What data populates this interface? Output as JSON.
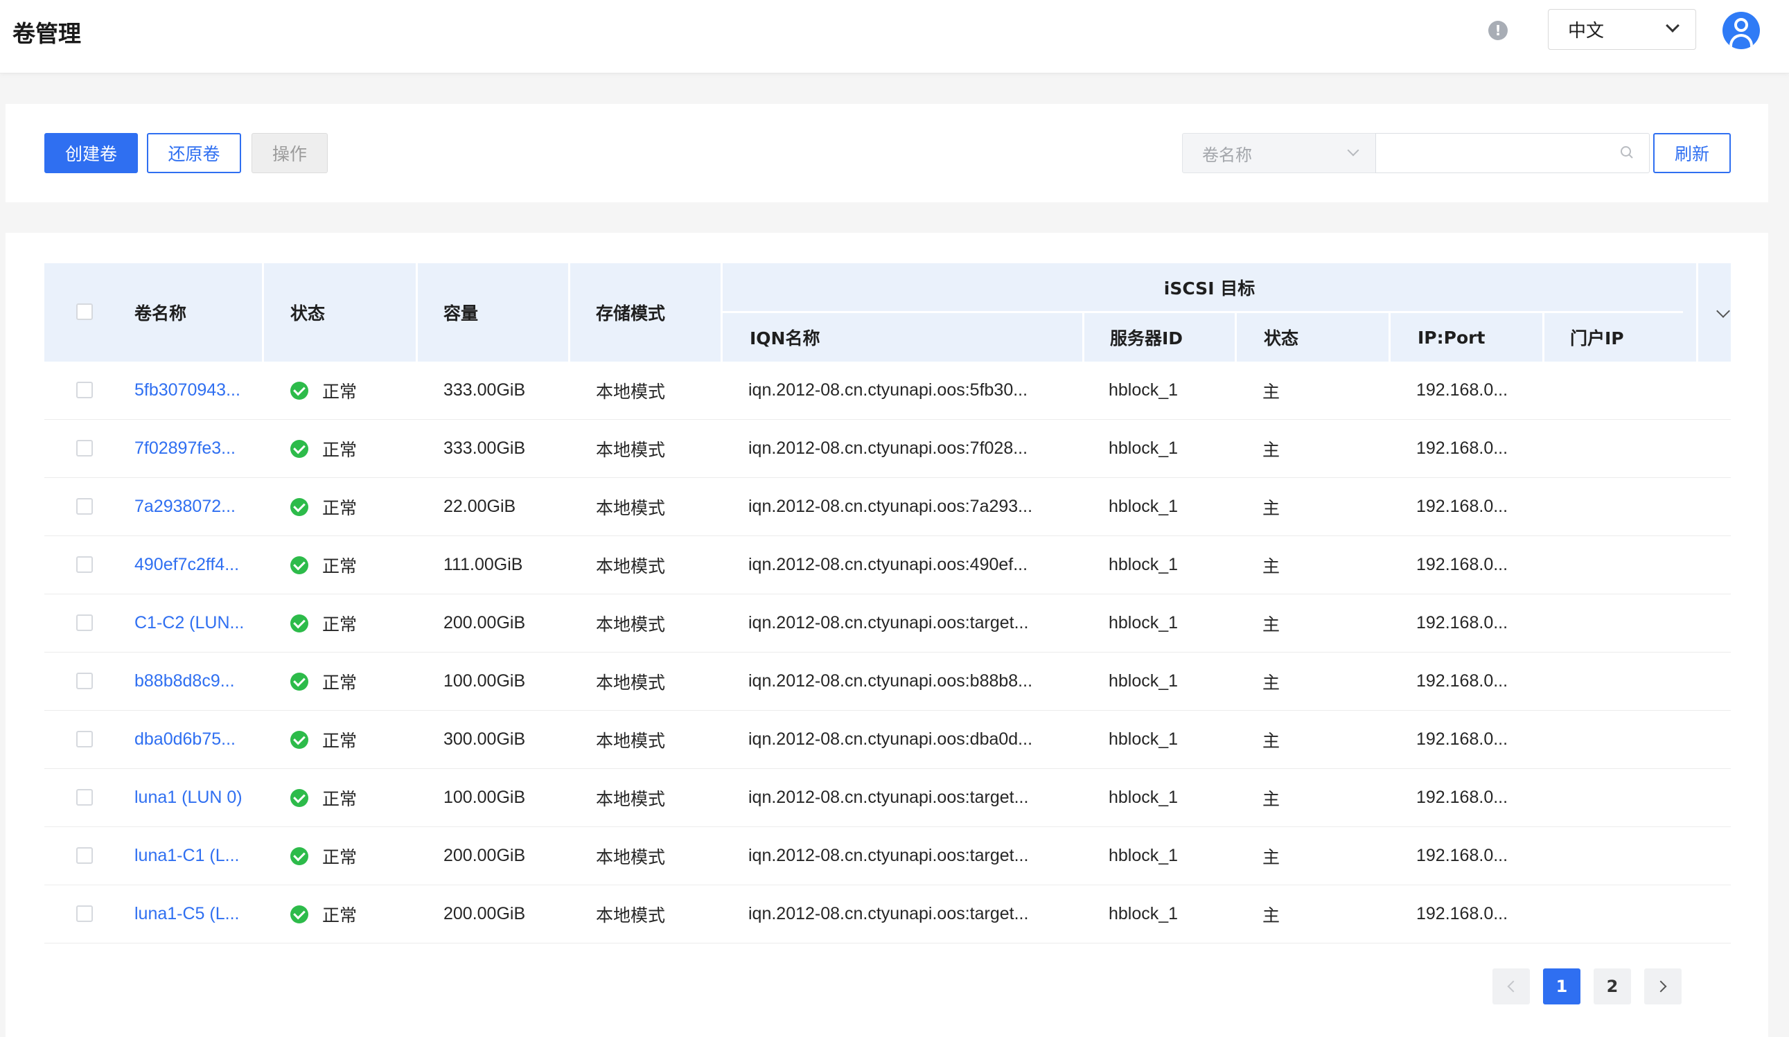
{
  "header": {
    "title": "卷管理",
    "info_icon": "!",
    "language": "中文"
  },
  "toolbar": {
    "create_label": "创建卷",
    "restore_label": "还原卷",
    "operate_label": "操作",
    "search_field": "卷名称",
    "search_value": "",
    "refresh_label": "刷新"
  },
  "table": {
    "columns": {
      "name": "卷名称",
      "status": "状态",
      "capacity": "容量",
      "storage_mode": "存储模式",
      "iscsi_group": "iSCSI 目标",
      "iqn": "IQN名称",
      "server_id": "服务器ID",
      "iscsi_status": "状态",
      "ip_port": "IP:Port",
      "portal_ip": "门户IP"
    },
    "rows": [
      {
        "name": "5fb3070943...",
        "status": "正常",
        "capacity": "333.00GiB",
        "mode": "本地模式",
        "iqn": "iqn.2012-08.cn.ctyunapi.oos:5fb30...",
        "server": "hblock_1",
        "role": "主",
        "ip": "192.168.0...",
        "portal": ""
      },
      {
        "name": "7f02897fe3...",
        "status": "正常",
        "capacity": "333.00GiB",
        "mode": "本地模式",
        "iqn": "iqn.2012-08.cn.ctyunapi.oos:7f028...",
        "server": "hblock_1",
        "role": "主",
        "ip": "192.168.0...",
        "portal": ""
      },
      {
        "name": "7a2938072...",
        "status": "正常",
        "capacity": "22.00GiB",
        "mode": "本地模式",
        "iqn": "iqn.2012-08.cn.ctyunapi.oos:7a293...",
        "server": "hblock_1",
        "role": "主",
        "ip": "192.168.0...",
        "portal": ""
      },
      {
        "name": "490ef7c2ff4...",
        "status": "正常",
        "capacity": "111.00GiB",
        "mode": "本地模式",
        "iqn": "iqn.2012-08.cn.ctyunapi.oos:490ef...",
        "server": "hblock_1",
        "role": "主",
        "ip": "192.168.0...",
        "portal": ""
      },
      {
        "name": "C1-C2 (LUN...",
        "status": "正常",
        "capacity": "200.00GiB",
        "mode": "本地模式",
        "iqn": "iqn.2012-08.cn.ctyunapi.oos:target...",
        "server": "hblock_1",
        "role": "主",
        "ip": "192.168.0...",
        "portal": ""
      },
      {
        "name": "b88b8d8c9...",
        "status": "正常",
        "capacity": "100.00GiB",
        "mode": "本地模式",
        "iqn": "iqn.2012-08.cn.ctyunapi.oos:b88b8...",
        "server": "hblock_1",
        "role": "主",
        "ip": "192.168.0...",
        "portal": ""
      },
      {
        "name": "dba0d6b75...",
        "status": "正常",
        "capacity": "300.00GiB",
        "mode": "本地模式",
        "iqn": "iqn.2012-08.cn.ctyunapi.oos:dba0d...",
        "server": "hblock_1",
        "role": "主",
        "ip": "192.168.0...",
        "portal": ""
      },
      {
        "name": "luna1 (LUN 0)",
        "status": "正常",
        "capacity": "100.00GiB",
        "mode": "本地模式",
        "iqn": "iqn.2012-08.cn.ctyunapi.oos:target...",
        "server": "hblock_1",
        "role": "主",
        "ip": "192.168.0...",
        "portal": ""
      },
      {
        "name": "luna1-C1 (L...",
        "status": "正常",
        "capacity": "200.00GiB",
        "mode": "本地模式",
        "iqn": "iqn.2012-08.cn.ctyunapi.oos:target...",
        "server": "hblock_1",
        "role": "主",
        "ip": "192.168.0...",
        "portal": ""
      },
      {
        "name": "luna1-C5 (L...",
        "status": "正常",
        "capacity": "200.00GiB",
        "mode": "本地模式",
        "iqn": "iqn.2012-08.cn.ctyunapi.oos:target...",
        "server": "hblock_1",
        "role": "主",
        "ip": "192.168.0...",
        "portal": ""
      }
    ]
  },
  "pagination": {
    "pages": [
      "1",
      "2"
    ],
    "current": "1"
  },
  "colors": {
    "primary": "#2f6ff1",
    "success": "#2dbb4a",
    "header_bg": "#eaf1fb"
  }
}
